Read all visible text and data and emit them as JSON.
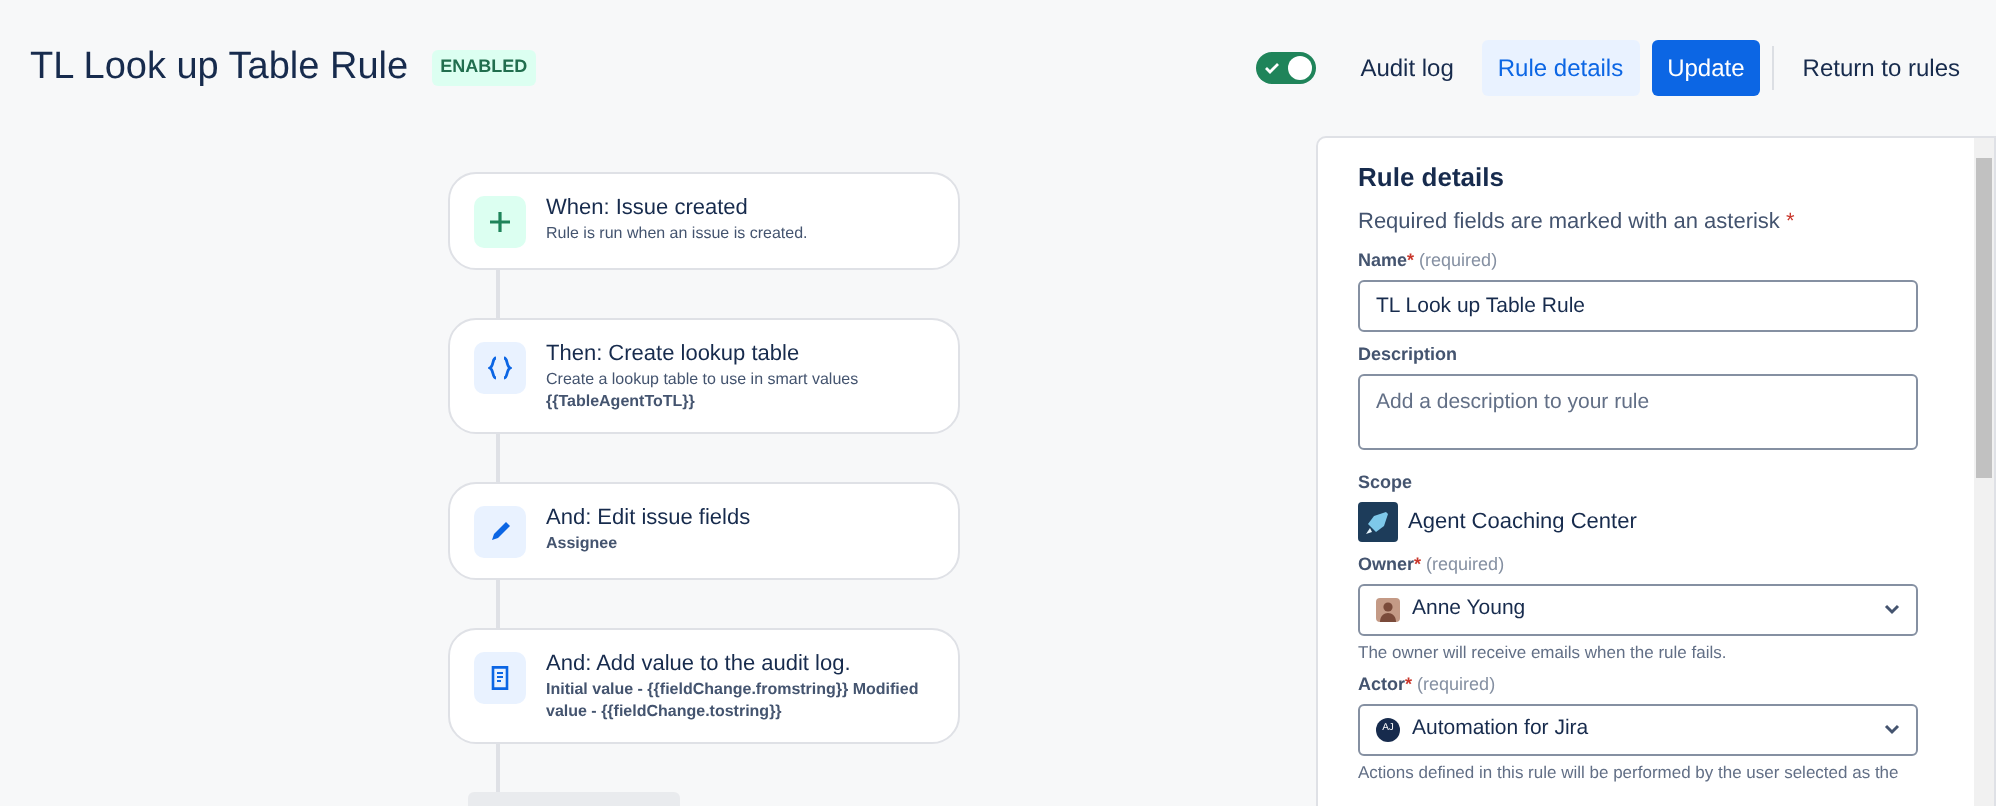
{
  "title": "TL Look up Table Rule",
  "status": "ENABLED",
  "toolbar": {
    "toggle": {
      "on": true
    },
    "buttons": [
      {
        "label": "Audit log",
        "kind": "subtle"
      },
      {
        "label": "Rule details",
        "kind": "selected"
      },
      {
        "label": "Update",
        "kind": "primary"
      },
      {
        "label": "Return to rules",
        "kind": "subtle"
      }
    ]
  },
  "steps": [
    {
      "title": "When: Issue created",
      "details": [
        {
          "text": "Rule is run when an issue is created.",
          "bold": false
        }
      ]
    },
    {
      "title": "Then: Create lookup table",
      "details": [
        {
          "text": "Create a lookup table to use in smart values",
          "bold": false
        },
        {
          "text": "{{TableAgentToTL}}",
          "bold": true
        }
      ]
    },
    {
      "title": "And: Edit issue fields",
      "details": [
        {
          "text": "Assignee",
          "bold": true
        }
      ]
    },
    {
      "title": "And: Add value to the audit log.",
      "details": [
        {
          "text": "Initial value - {{fieldChange.fromstring}} Modified value - {{fieldChange.tostring}}",
          "bold": true
        }
      ]
    }
  ],
  "panel": {
    "heading": "Rule details",
    "note": "Required fields are marked with an asterisk",
    "note_mark": "*",
    "fields": [
      {
        "kind": "text",
        "label": "Name",
        "required_mark": "*",
        "required_text": "(required)",
        "value": "TL Look up Table Rule"
      },
      {
        "kind": "textarea",
        "label": "Description",
        "placeholder": "Add a description to your rule"
      },
      {
        "kind": "scope",
        "label": "Scope",
        "value": "Agent Coaching Center"
      },
      {
        "kind": "select",
        "label": "Owner",
        "required_mark": "*",
        "required_text": "(required)",
        "value": "Anne Young",
        "help": "The owner will receive emails when the rule fails."
      },
      {
        "kind": "select",
        "label": "Actor",
        "required_mark": "*",
        "required_text": "(required)",
        "value": "Automation for Jira",
        "avatar_text": "AJ",
        "help": "Actions defined in this rule will be performed by the user selected as the"
      }
    ]
  }
}
